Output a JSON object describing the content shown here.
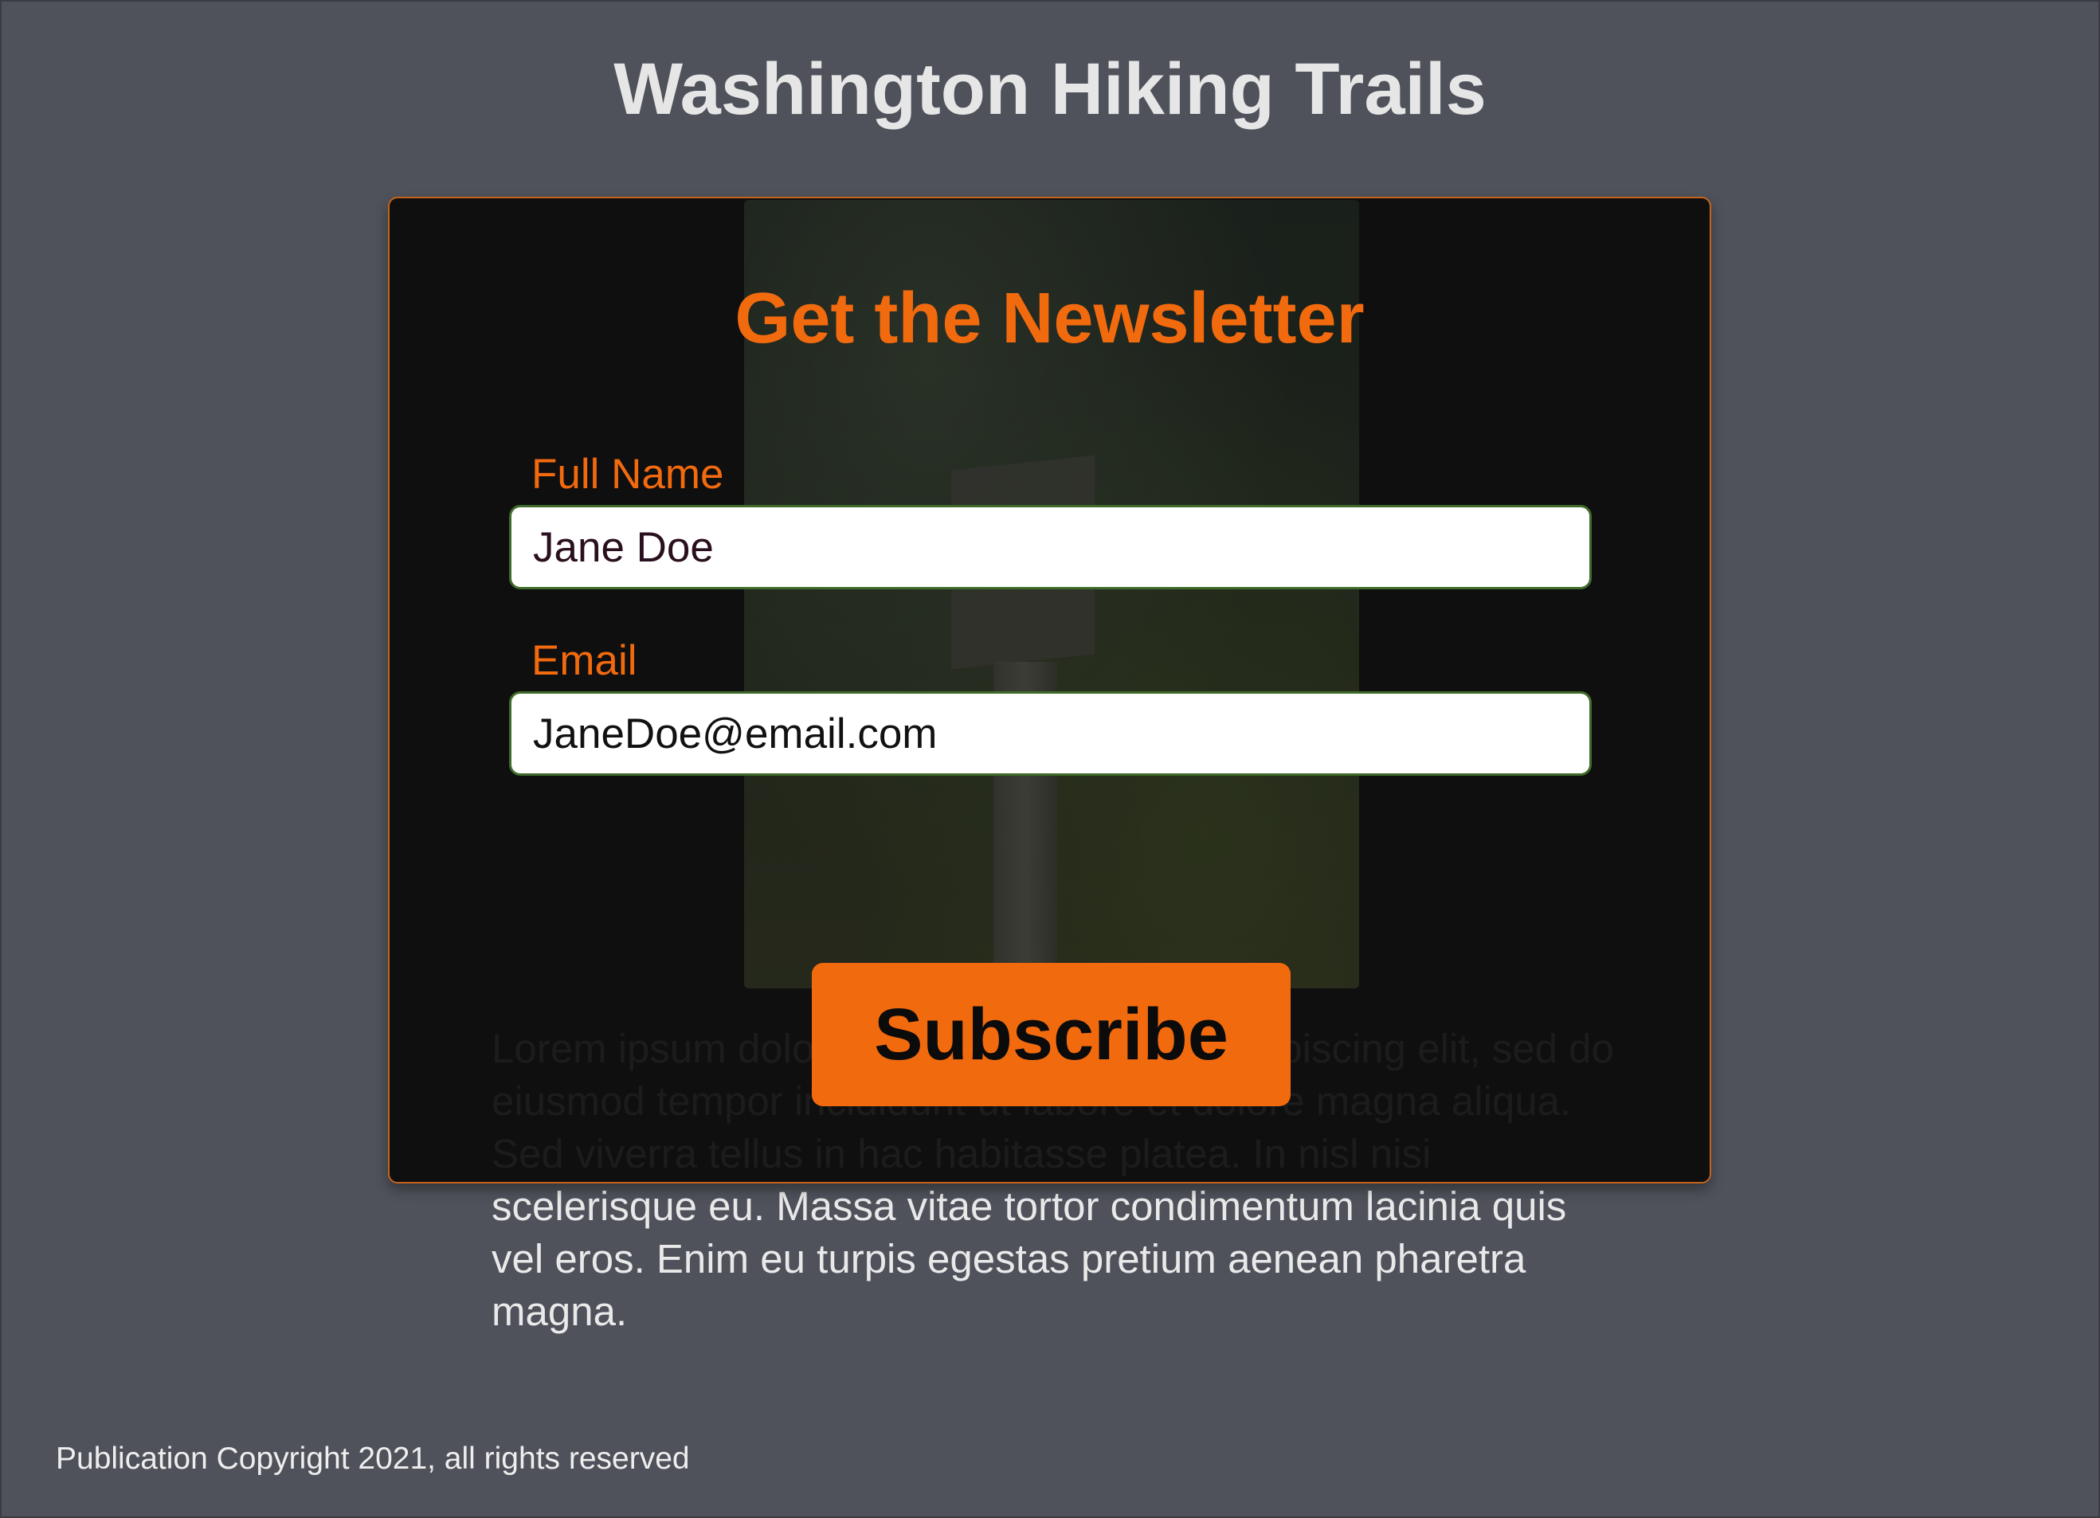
{
  "header": {
    "title": "Washington Hiking Trails"
  },
  "article": {
    "body": "Lorem ipsum dolor sit amet, consectetur adipiscing elit, sed do eiusmod tempor incididunt ut labore et dolore magna aliqua. Sed viverra tellus in hac habitasse platea. In nisl nisi scelerisque eu. Massa vitae tortor condimentum lacinia quis vel eros. Enim eu turpis egestas pretium aenean pharetra magna."
  },
  "modal": {
    "title": "Get the Newsletter",
    "full_name": {
      "label": "Full Name",
      "value": "Jane Doe"
    },
    "email": {
      "label": "Email",
      "value": "JaneDoe@email.com"
    },
    "subscribe_label": "Subscribe"
  },
  "footer": {
    "copyright": "Publication Copyright 2021, all rights reserved"
  },
  "colors": {
    "background": "#4f525b",
    "accent": "#f26a0e",
    "input_border": "#3f6b2a"
  }
}
